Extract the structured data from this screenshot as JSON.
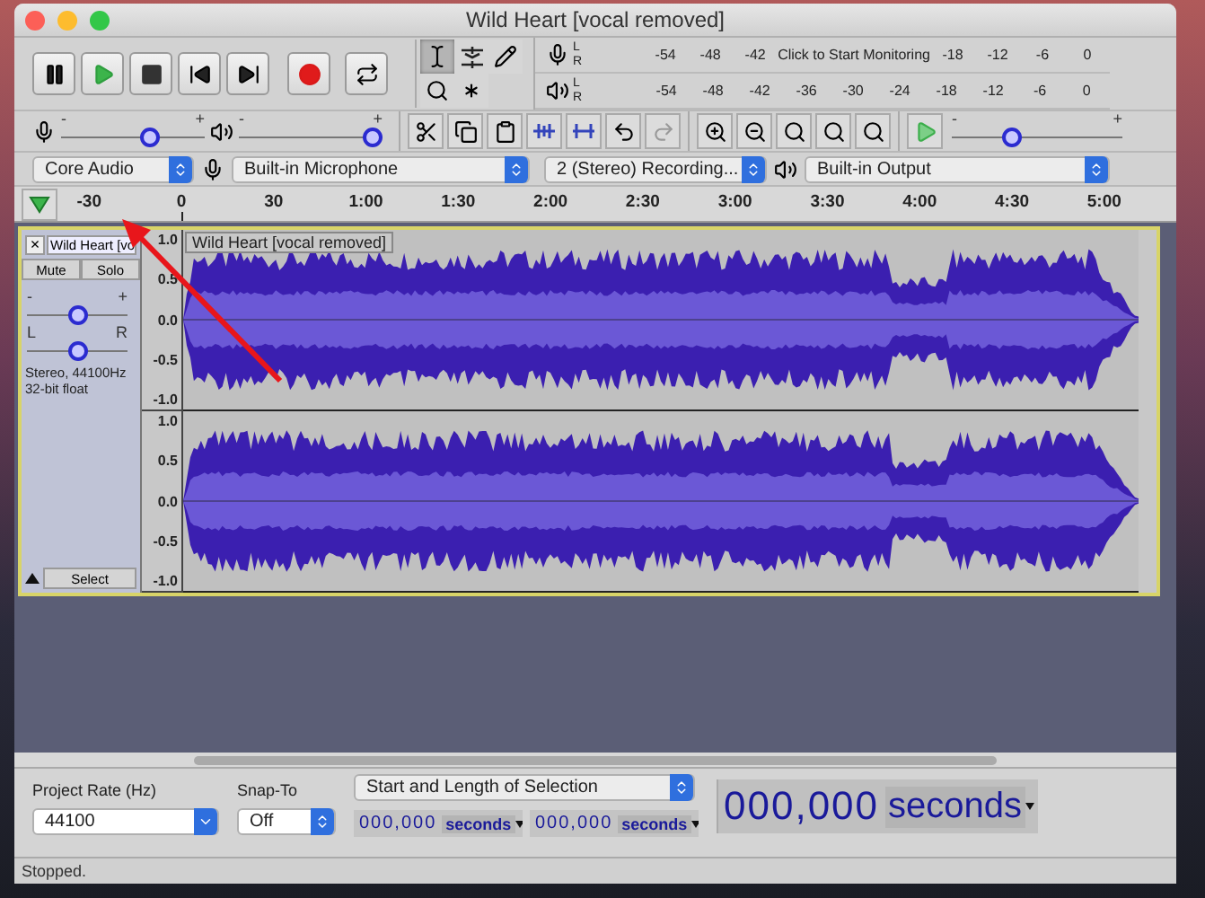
{
  "window": {
    "title": "Wild Heart [vocal removed]"
  },
  "tools": [
    {
      "kind": "select",
      "selected": true
    },
    {
      "kind": "envelope",
      "selected": false
    },
    {
      "kind": "draw",
      "selected": false
    },
    {
      "kind": "zoom",
      "selected": false
    },
    {
      "kind": "multi",
      "selected": false
    }
  ],
  "meters": {
    "record_channels": [
      "L",
      "R"
    ],
    "playback_channels": [
      "L",
      "R"
    ],
    "record": {
      "ticks": [
        "-54",
        "-48",
        "-42",
        "-18",
        "-12",
        "-6",
        "0"
      ],
      "prompt": "Click to Start Monitoring"
    },
    "playback": {
      "ticks": [
        "-54",
        "-48",
        "-42",
        "-36",
        "-30",
        "-24",
        "-18",
        "-12",
        "-6",
        "0"
      ]
    }
  },
  "mixer": {
    "record_volume": {
      "level": 0.64,
      "min": "-",
      "max": "+"
    },
    "playback_volume": {
      "level": 1.0,
      "min": "-",
      "max": "+"
    }
  },
  "play_at_speed": {
    "level": 0.33,
    "min": "-",
    "max": "+"
  },
  "devices": {
    "host": "Core Audio",
    "recording_device": "Built-in Microphone",
    "channels": "2 (Stereo) Recording...",
    "playback_device": "Built-in Output"
  },
  "timeline": {
    "labels": [
      "-30",
      "0",
      "30",
      "1:00",
      "1:30",
      "2:00",
      "2:30",
      "3:00",
      "3:30",
      "4:00",
      "4:30",
      "5:00"
    ]
  },
  "track": {
    "close": "×",
    "name": "Wild Heart [vo",
    "mute": "Mute",
    "solo": "Solo",
    "gain": {
      "level": 0.5,
      "min": "-",
      "max": "+"
    },
    "pan": {
      "level": 0.5,
      "min": "L",
      "max": "R"
    },
    "info": [
      "Stereo, 44100Hz",
      "32-bit float"
    ],
    "select": "Select",
    "title": "Wild Heart [vocal removed]",
    "channels": [
      {
        "scale": [
          "1.0",
          "0.5",
          "0.0",
          "-0.5",
          "-1.0"
        ]
      },
      {
        "scale": [
          "1.0",
          "0.5",
          "0.0",
          "-0.5",
          "-1.0"
        ]
      }
    ]
  },
  "selection_bar": {
    "project_rate_label": "Project Rate (Hz)",
    "project_rate": "44100",
    "snap_label": "Snap-To",
    "snap": "Off",
    "selection_mode": "Start and Length of Selection",
    "start": {
      "digits": "000,000",
      "unit": "seconds"
    },
    "length": {
      "digits": "000,000",
      "unit": "seconds"
    },
    "audio_position": {
      "digits": "000,000",
      "unit": "seconds"
    }
  },
  "status_bar": {
    "text": "Stopped."
  }
}
